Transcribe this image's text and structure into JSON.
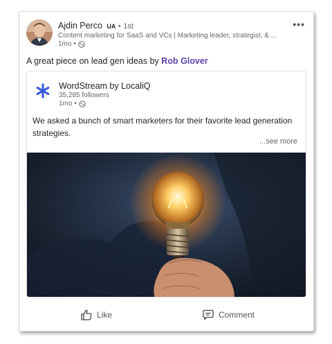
{
  "post": {
    "author": {
      "name": "Ajdin Perco",
      "badge": "UA",
      "separator": "•",
      "degree": "1st",
      "headline": "Content marketing for SaaS and VCs | Marketing leader, strategist, & ...",
      "time": "1mo •"
    },
    "text_prefix": "A great piece on lead gen ideas by ",
    "mention": "Rob Glover",
    "shared": {
      "company_name": "WordStream by LocaliQ",
      "followers": "35,285 followers",
      "time": "1mo •",
      "text": "We asked a bunch of smart marketers for their favorite lead generation strategies.",
      "see_more": "...see more"
    }
  },
  "actions": {
    "like_label": "Like",
    "comment_label": "Comment"
  },
  "colors": {
    "mention": "#5b43a8",
    "logo": "#3b5bdb"
  },
  "icons": [
    "globe-icon",
    "more-options-icon",
    "like-thumb-icon",
    "comment-bubble-icon",
    "wordstream-logo-icon"
  ]
}
